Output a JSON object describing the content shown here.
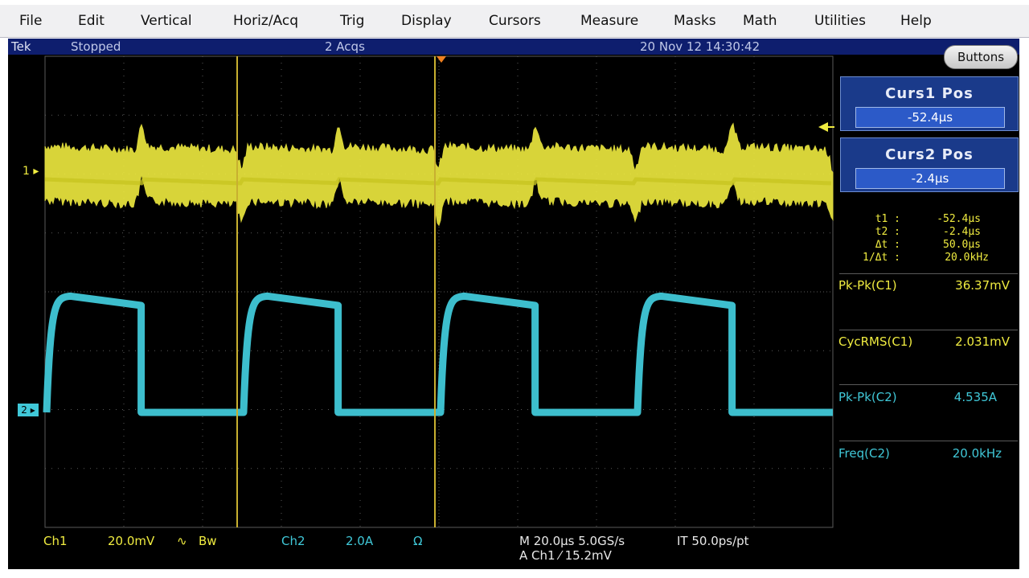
{
  "menu": [
    "File",
    "Edit",
    "Vertical",
    "Horiz/Acq",
    "Trig",
    "Display",
    "Cursors",
    "Measure",
    "Masks",
    "Math",
    "Utilities",
    "Help"
  ],
  "status": {
    "brand": "Tek",
    "state": "Stopped",
    "acqs": "2 Acqs",
    "datetime": "20 Nov 12 14:30:42"
  },
  "buttons_label": "Buttons",
  "cursors": {
    "curs1_title": "Curs1 Pos",
    "curs1_value": "-52.4µs",
    "curs2_title": "Curs2 Pos",
    "curs2_value": "-2.4µs"
  },
  "cursor_readout": [
    {
      "label": "t1 :",
      "value": "-52.4µs"
    },
    {
      "label": "t2 :",
      "value": "-2.4µs"
    },
    {
      "label": "Δt :",
      "value": "50.0µs"
    },
    {
      "label": "1/Δt :",
      "value": "20.0kHz"
    }
  ],
  "measurements": [
    {
      "label": "Pk-Pk(C1)",
      "value": "36.37mV",
      "channel": "ch1"
    },
    {
      "label": "CycRMS(C1)",
      "value": "2.031mV",
      "channel": "ch1"
    },
    {
      "label": "Pk-Pk(C2)",
      "value": "4.535A",
      "channel": "ch2"
    },
    {
      "label": "Freq(C2)",
      "value": "20.0kHz",
      "channel": "ch2"
    }
  ],
  "channel_markers": {
    "ch1": "1",
    "ch2": "2"
  },
  "bottom": {
    "ch1_label": "Ch1",
    "ch1_scale": "20.0mV",
    "ch1_bw": "Bw",
    "ch2_label": "Ch2",
    "ch2_scale": "2.0A",
    "ch2_ohm": "Ω",
    "timebase": "M 20.0µs 5.0GS/s",
    "interp": "IT 50.0ps/pt",
    "trigger": "A  Ch1  ⁄  15.2mV"
  },
  "colors": {
    "ch1": "#f0ec40",
    "ch2": "#40c8d8",
    "cursor": "#c8b030",
    "trigger_marker": "#f08020",
    "grid": "#5a5a5a"
  }
}
